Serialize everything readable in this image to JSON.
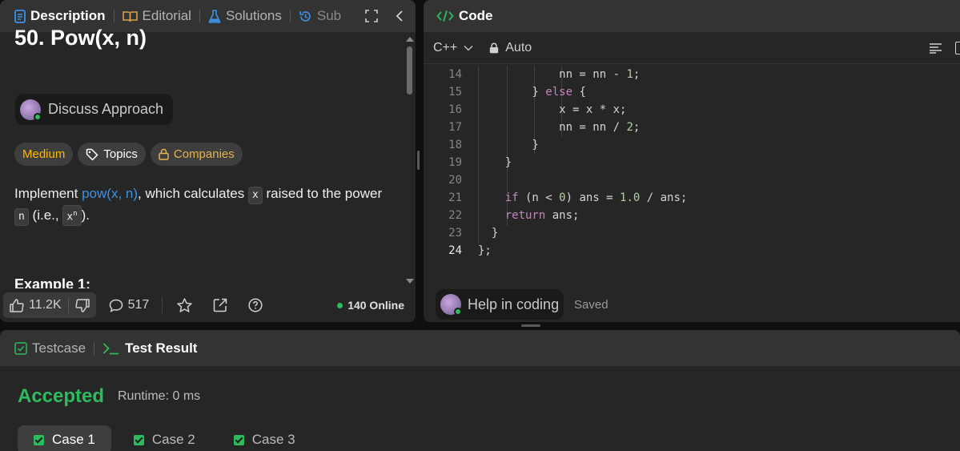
{
  "description_tabs": [
    {
      "label": "Description",
      "active": true
    },
    {
      "label": "Editorial",
      "active": false
    },
    {
      "label": "Solutions",
      "active": false
    },
    {
      "label": "Sub",
      "active": false
    }
  ],
  "problem": {
    "title": "50. Pow(x, n)",
    "discuss_label": "Discuss Approach",
    "tags": {
      "difficulty": "Medium",
      "topics": "Topics",
      "companies": "Companies"
    },
    "statement": {
      "prefix": "Implement ",
      "link": "pow(x, n)",
      "middle": ", which calculates ",
      "x": "x",
      "raised": " raised to the power",
      "n": "n",
      "ie": " (i.e., ",
      "xn_base": "x",
      "xn_exp": "n",
      "suffix": ")."
    },
    "example_heading": "Example 1:"
  },
  "footer": {
    "likes": "11.2K",
    "comments": "517",
    "online": "140 Online"
  },
  "code_panel": {
    "title": "Code",
    "language": "C++",
    "mode": "Auto",
    "help_label": "Help in coding",
    "saved": "Saved",
    "lines": [
      {
        "n": "14",
        "html": "            nn = nn - <span class=\"num\">1</span>;"
      },
      {
        "n": "15",
        "html": "        } <span class=\"kw\">else</span> {"
      },
      {
        "n": "16",
        "html": "            x = x * x;"
      },
      {
        "n": "17",
        "html": "            nn = nn / <span class=\"num\">2</span>;"
      },
      {
        "n": "18",
        "html": "        }"
      },
      {
        "n": "19",
        "html": "    }"
      },
      {
        "n": "20",
        "html": ""
      },
      {
        "n": "21",
        "html": "    <span class=\"kw\">if</span> (n &lt; <span class=\"num\">0</span>) ans = <span class=\"num\">1.0</span> / ans;"
      },
      {
        "n": "22",
        "html": "    <span class=\"kw\">return</span> ans;"
      },
      {
        "n": "23",
        "html": "  }"
      },
      {
        "n": "24",
        "html": "};"
      }
    ],
    "current_line": "24"
  },
  "test_panel": {
    "tabs": [
      {
        "label": "Testcase"
      },
      {
        "label": "Test Result"
      }
    ],
    "status": "Accepted",
    "runtime": "Runtime: 0 ms",
    "cases": [
      "Case 1",
      "Case 2",
      "Case 3"
    ]
  },
  "colors": {
    "accepted": "#2cbb5d",
    "medium": "#ffb800",
    "link": "#3c91e6"
  }
}
